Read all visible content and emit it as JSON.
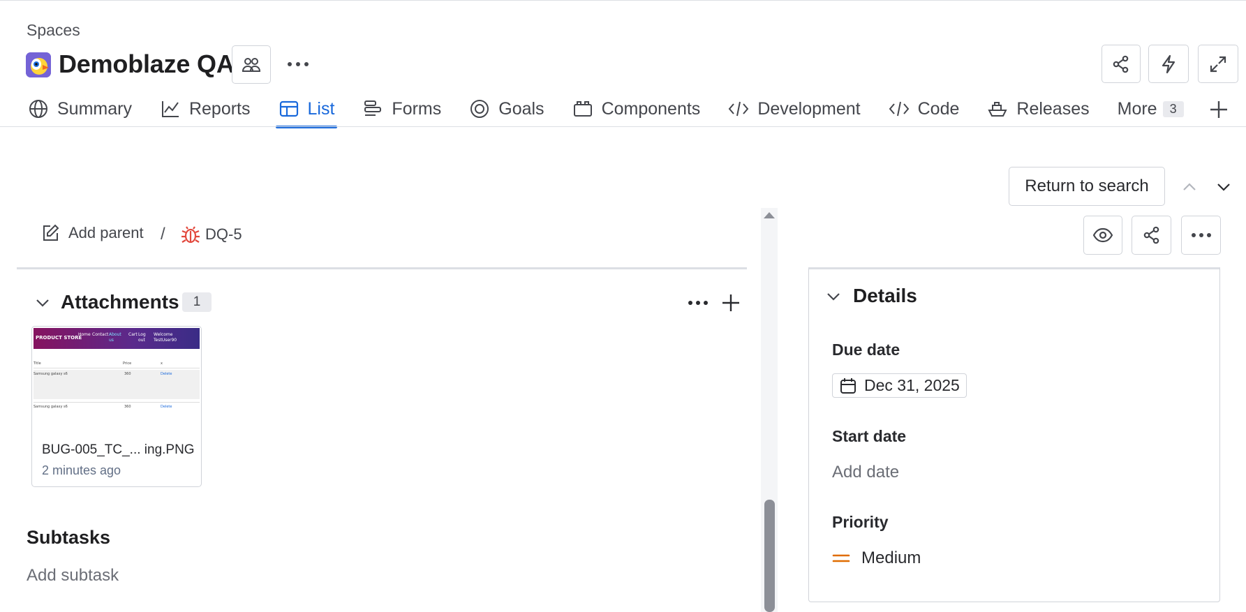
{
  "header": {
    "breadcrumb": "Spaces",
    "title": "Demoblaze QA",
    "brand_color": "#1868db"
  },
  "tabs": [
    {
      "label": "Summary",
      "icon": "globe-icon"
    },
    {
      "label": "Reports",
      "icon": "chart-line-icon"
    },
    {
      "label": "List",
      "icon": "table-icon",
      "active": true
    },
    {
      "label": "Forms",
      "icon": "form-icon"
    },
    {
      "label": "Goals",
      "icon": "target-icon"
    },
    {
      "label": "Components",
      "icon": "component-icon"
    },
    {
      "label": "Development",
      "icon": "code-brackets-icon"
    },
    {
      "label": "Code",
      "icon": "code-icon"
    },
    {
      "label": "Releases",
      "icon": "ship-icon"
    }
  ],
  "more_tab": {
    "label": "More",
    "count": "3"
  },
  "issue_nav": {
    "return_label": "Return to search"
  },
  "issue": {
    "add_parent_label": "Add parent",
    "separator": "/",
    "key": "DQ-5"
  },
  "attachments": {
    "title": "Attachments",
    "count": "1",
    "items": [
      {
        "name": "BUG-005_TC_... ing.PNG",
        "time": "2 minutes ago",
        "thumbnail": {
          "store_name": "PRODUCT STORE",
          "nav": [
            "Home",
            "Contact",
            "About us",
            "Cart",
            "Log out",
            "Welcome TestUser90"
          ],
          "columns": [
            "Title",
            "Price",
            "x"
          ],
          "rows": [
            {
              "title": "Samsung galaxy s6",
              "price": "360",
              "action": "Delete"
            },
            {
              "title": "Samsung galaxy s6",
              "price": "360",
              "action": "Delete"
            }
          ]
        }
      }
    ]
  },
  "subtasks": {
    "title": "Subtasks",
    "add_label": "Add subtask"
  },
  "details": {
    "title": "Details",
    "due_date_label": "Due date",
    "due_date_value": "Dec 31, 2025",
    "start_date_label": "Start date",
    "start_date_value": "Add date",
    "priority_label": "Priority",
    "priority_value": "Medium",
    "priority_color": "#e06c00"
  }
}
